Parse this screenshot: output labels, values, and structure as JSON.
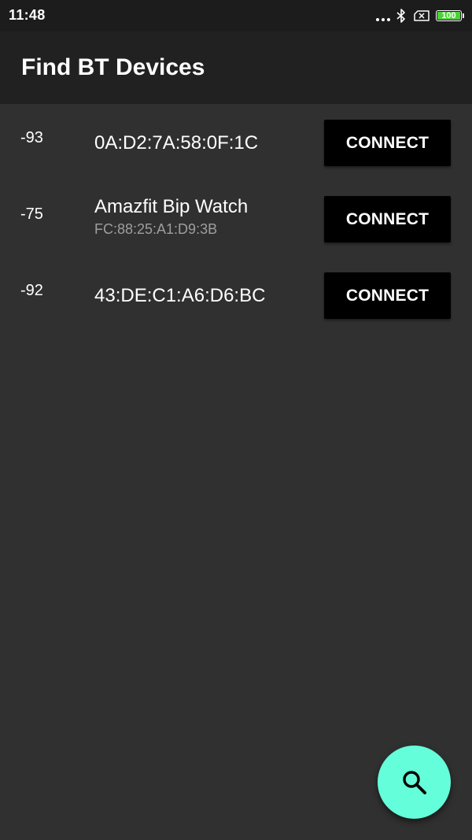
{
  "status_bar": {
    "time": "11:48",
    "battery_level": "100",
    "battery_color": "#4cd137",
    "icons": [
      "more-dots-icon",
      "bluetooth-icon",
      "sim-x-icon",
      "battery-icon"
    ]
  },
  "app_bar": {
    "title": "Find BT Devices"
  },
  "devices": [
    {
      "rssi": "-93",
      "name": "0A:D2:7A:58:0F:1C",
      "address": "",
      "connect_label": "CONNECT"
    },
    {
      "rssi": "-75",
      "name": "Amazfit Bip Watch",
      "address": "FC:88:25:A1:D9:3B",
      "connect_label": "CONNECT"
    },
    {
      "rssi": "-92",
      "name": "43:DE:C1:A6:D6:BC",
      "address": "",
      "connect_label": "CONNECT"
    }
  ],
  "fab": {
    "icon": "search-icon",
    "color": "#64ffda"
  },
  "colors": {
    "background": "#303030",
    "app_bar": "#212121",
    "status_bar": "#1c1c1c",
    "button": "#000000",
    "secondary_text": "#9e9e9e"
  }
}
